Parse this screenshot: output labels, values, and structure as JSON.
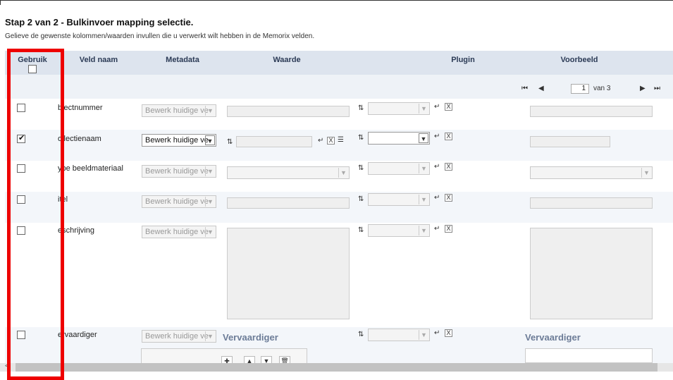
{
  "page": {
    "title": "Stap 2 van 2 - Bulkinvoer mapping selectie.",
    "subtitle": "Gelieve de gewenste kolommen/waarden invullen die u verwerkt wilt hebben in de Memorix velden."
  },
  "columns": {
    "gebruik": "Gebruik",
    "veld_naam": "Veld naam",
    "metadata": "Metadata",
    "waarde": "Waarde",
    "plugin": "Plugin",
    "voorbeeld": "Voorbeeld"
  },
  "pager": {
    "first": "⏮",
    "prev": "◀",
    "page": "1",
    "of_label": "van 3",
    "next": "▶",
    "last": "⏭"
  },
  "rows": [
    {
      "label": "bjectnummer",
      "checked": false,
      "metadata": "Bewerk huidige ve"
    },
    {
      "label": "ollectienaam",
      "checked": true,
      "metadata": "Bewerk huidige ve"
    },
    {
      "label": "ype beeldmateriaal",
      "checked": false,
      "metadata": "Bewerk huidige ve"
    },
    {
      "label": "itel",
      "checked": false,
      "metadata": "Bewerk huidige ve"
    },
    {
      "label": "eschrijving",
      "checked": false,
      "metadata": "Bewerk huidige ve"
    },
    {
      "label": "ervaardiger",
      "checked": false,
      "metadata": "Bewerk huidige ve",
      "waarde_heading": "Vervaardiger",
      "voorbeeld_heading": "Vervaardiger"
    }
  ],
  "icons": {
    "swap": "⇅",
    "enter": "↵",
    "close": "X",
    "list": "☰",
    "dropdown": "▼"
  },
  "toolbar": {
    "add": "✚",
    "up": "▲",
    "down": "▼",
    "delete": "🗑"
  },
  "scroll": {
    "left": "<"
  },
  "colors": {
    "header_bg": "#dde4ee",
    "highlight": "#ee0000",
    "heading_blue": "#6c7c97"
  }
}
